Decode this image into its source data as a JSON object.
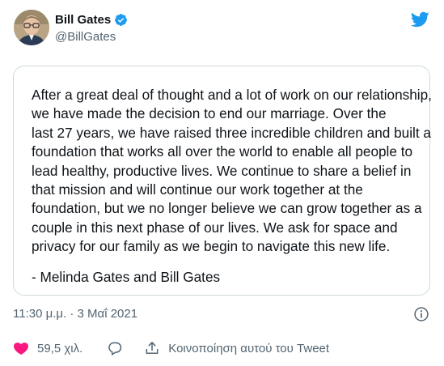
{
  "author": {
    "display_name": "Bill Gates",
    "handle": "@BillGates",
    "verified": true,
    "avatar_icon": "avatar-photo"
  },
  "brand": {
    "logo_icon": "twitter-bird-icon",
    "accent_color": "#1d9bf0"
  },
  "statement": {
    "lines": [
      "After a great deal of thought and a lot of work on our relationship,",
      "we have made the decision to end our marriage. Over the",
      "last 27 years, we have raised three incredible children and built a",
      "foundation that works all over the world to enable all people to",
      "lead healthy, productive lives. We continue to share a belief in",
      "that mission and will continue our work together at the",
      "foundation, but we no longer believe we can grow together as a",
      "couple in this next phase of our lives. We ask for space and",
      "privacy for our family as we begin to navigate this new life."
    ],
    "signature": "- Melinda Gates and Bill Gates"
  },
  "meta": {
    "timestamp": "11:30 μ.μ. · 3 Μαΐ 2021"
  },
  "actions": {
    "like_count": "59,5 χιλ.",
    "share_label": "Κοινοποίηση αυτού του Tweet"
  }
}
